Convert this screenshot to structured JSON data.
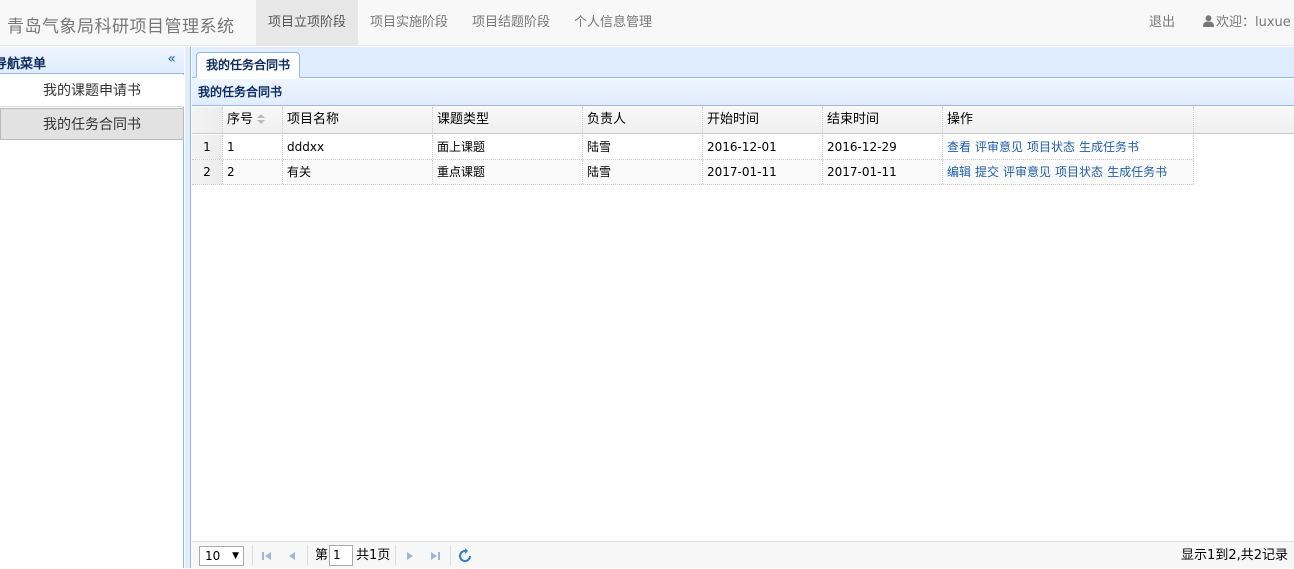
{
  "navbar": {
    "brand": "青岛气象局科研项目管理系统",
    "tabs": [
      {
        "label": "项目立项阶段",
        "active": true
      },
      {
        "label": "项目实施阶段",
        "active": false
      },
      {
        "label": "项目结题阶段",
        "active": false
      },
      {
        "label": "个人信息管理",
        "active": false
      }
    ],
    "logout": "退出",
    "welcome": "欢迎：luxue"
  },
  "sidebar": {
    "title": "导航菜单",
    "collapse_icon": "double-chevron-left-icon",
    "items": [
      {
        "label": "我的课题申请书",
        "selected": false
      },
      {
        "label": "我的任务合同书",
        "selected": true
      }
    ]
  },
  "main": {
    "tab_label": "我的任务合同书",
    "panel_title": "我的任务合同书",
    "columns": [
      "序号",
      "项目名称",
      "课题类型",
      "负责人",
      "开始时间",
      "结束时间",
      "操作"
    ],
    "rows": [
      {
        "rownum": "1",
        "seq": "1",
        "name": "dddxx",
        "type": "面上课题",
        "owner": "陆雪",
        "start": "2016-12-01",
        "end": "2016-12-29",
        "actions": [
          "查看",
          "评审意见",
          "项目状态",
          "生成任务书"
        ]
      },
      {
        "rownum": "2",
        "seq": "2",
        "name": "有关",
        "type": "重点课题",
        "owner": "陆雪",
        "start": "2017-01-11",
        "end": "2017-01-11",
        "actions": [
          "编辑",
          "提交",
          "评审意见",
          "项目状态",
          "生成任务书"
        ]
      }
    ]
  },
  "pager": {
    "page_size": "10",
    "page_prefix": "第",
    "page_value": "1",
    "page_suffix": "共1页",
    "info": "显示1到2,共2记录"
  },
  "colors": {
    "accent_border": "#95b8e7",
    "link": "#1f5fa8",
    "header_text": "#0e2d5f"
  }
}
